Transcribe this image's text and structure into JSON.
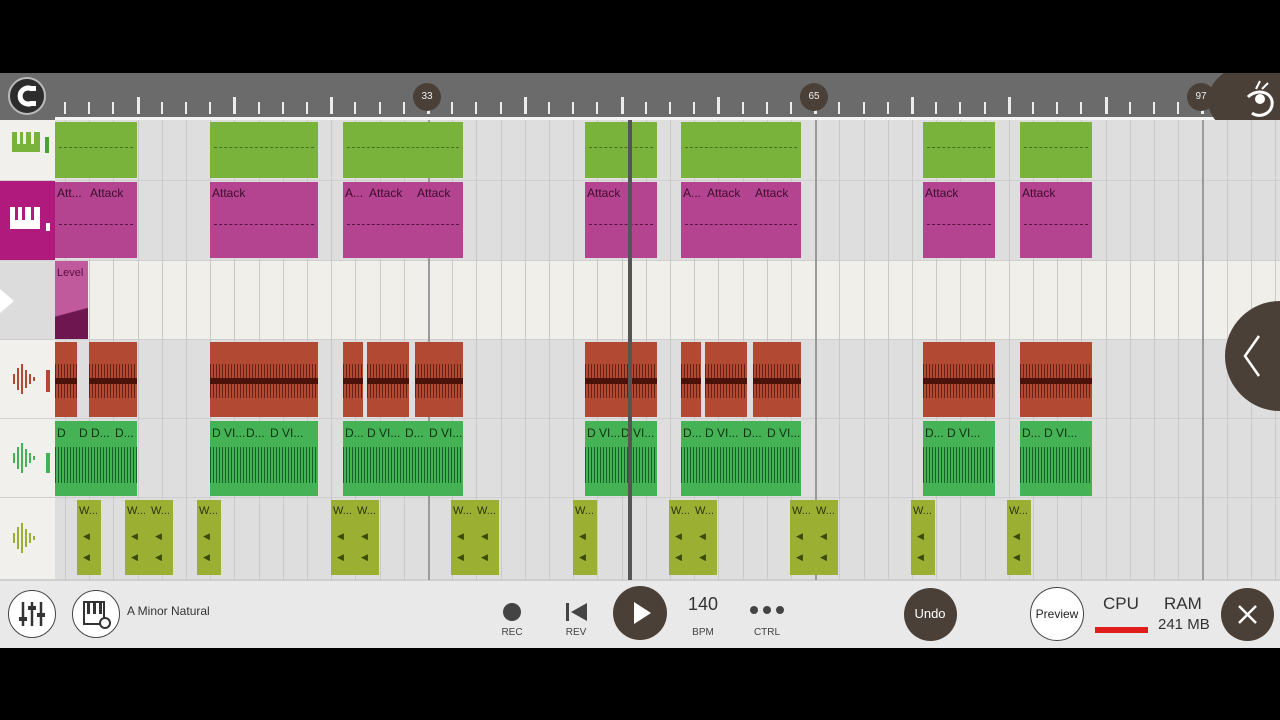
{
  "ruler": {
    "markers": [
      "33",
      "65",
      "97"
    ]
  },
  "clips": {
    "attack_label": "Attack",
    "attack_short_1": "Att...",
    "attack_short_2": "A...",
    "level_label": "Level",
    "drum_label_full": "D VI...",
    "drum_label_short": "D...",
    "drum_label_tiny": "D",
    "wav_label": "W..."
  },
  "toolbar": {
    "scale": "A Minor Natural",
    "rec_label": "REC",
    "rev_label": "REV",
    "bpm_value": "140",
    "bpm_label": "BPM",
    "ctrl_label": "CTRL",
    "undo_label": "Undo",
    "preview_label": "Preview",
    "cpu_label": "CPU",
    "ram_label": "RAM",
    "ram_value": "241 MB"
  },
  "colors": {
    "synth_track": "#7ab33c",
    "piano_track": "#b4448f",
    "drum_track": "#b24a33",
    "perc_track": "#45b256",
    "sample_track": "#9bb032",
    "accent_dark": "#4a4038",
    "cpu_bar": "#e01c1c"
  }
}
